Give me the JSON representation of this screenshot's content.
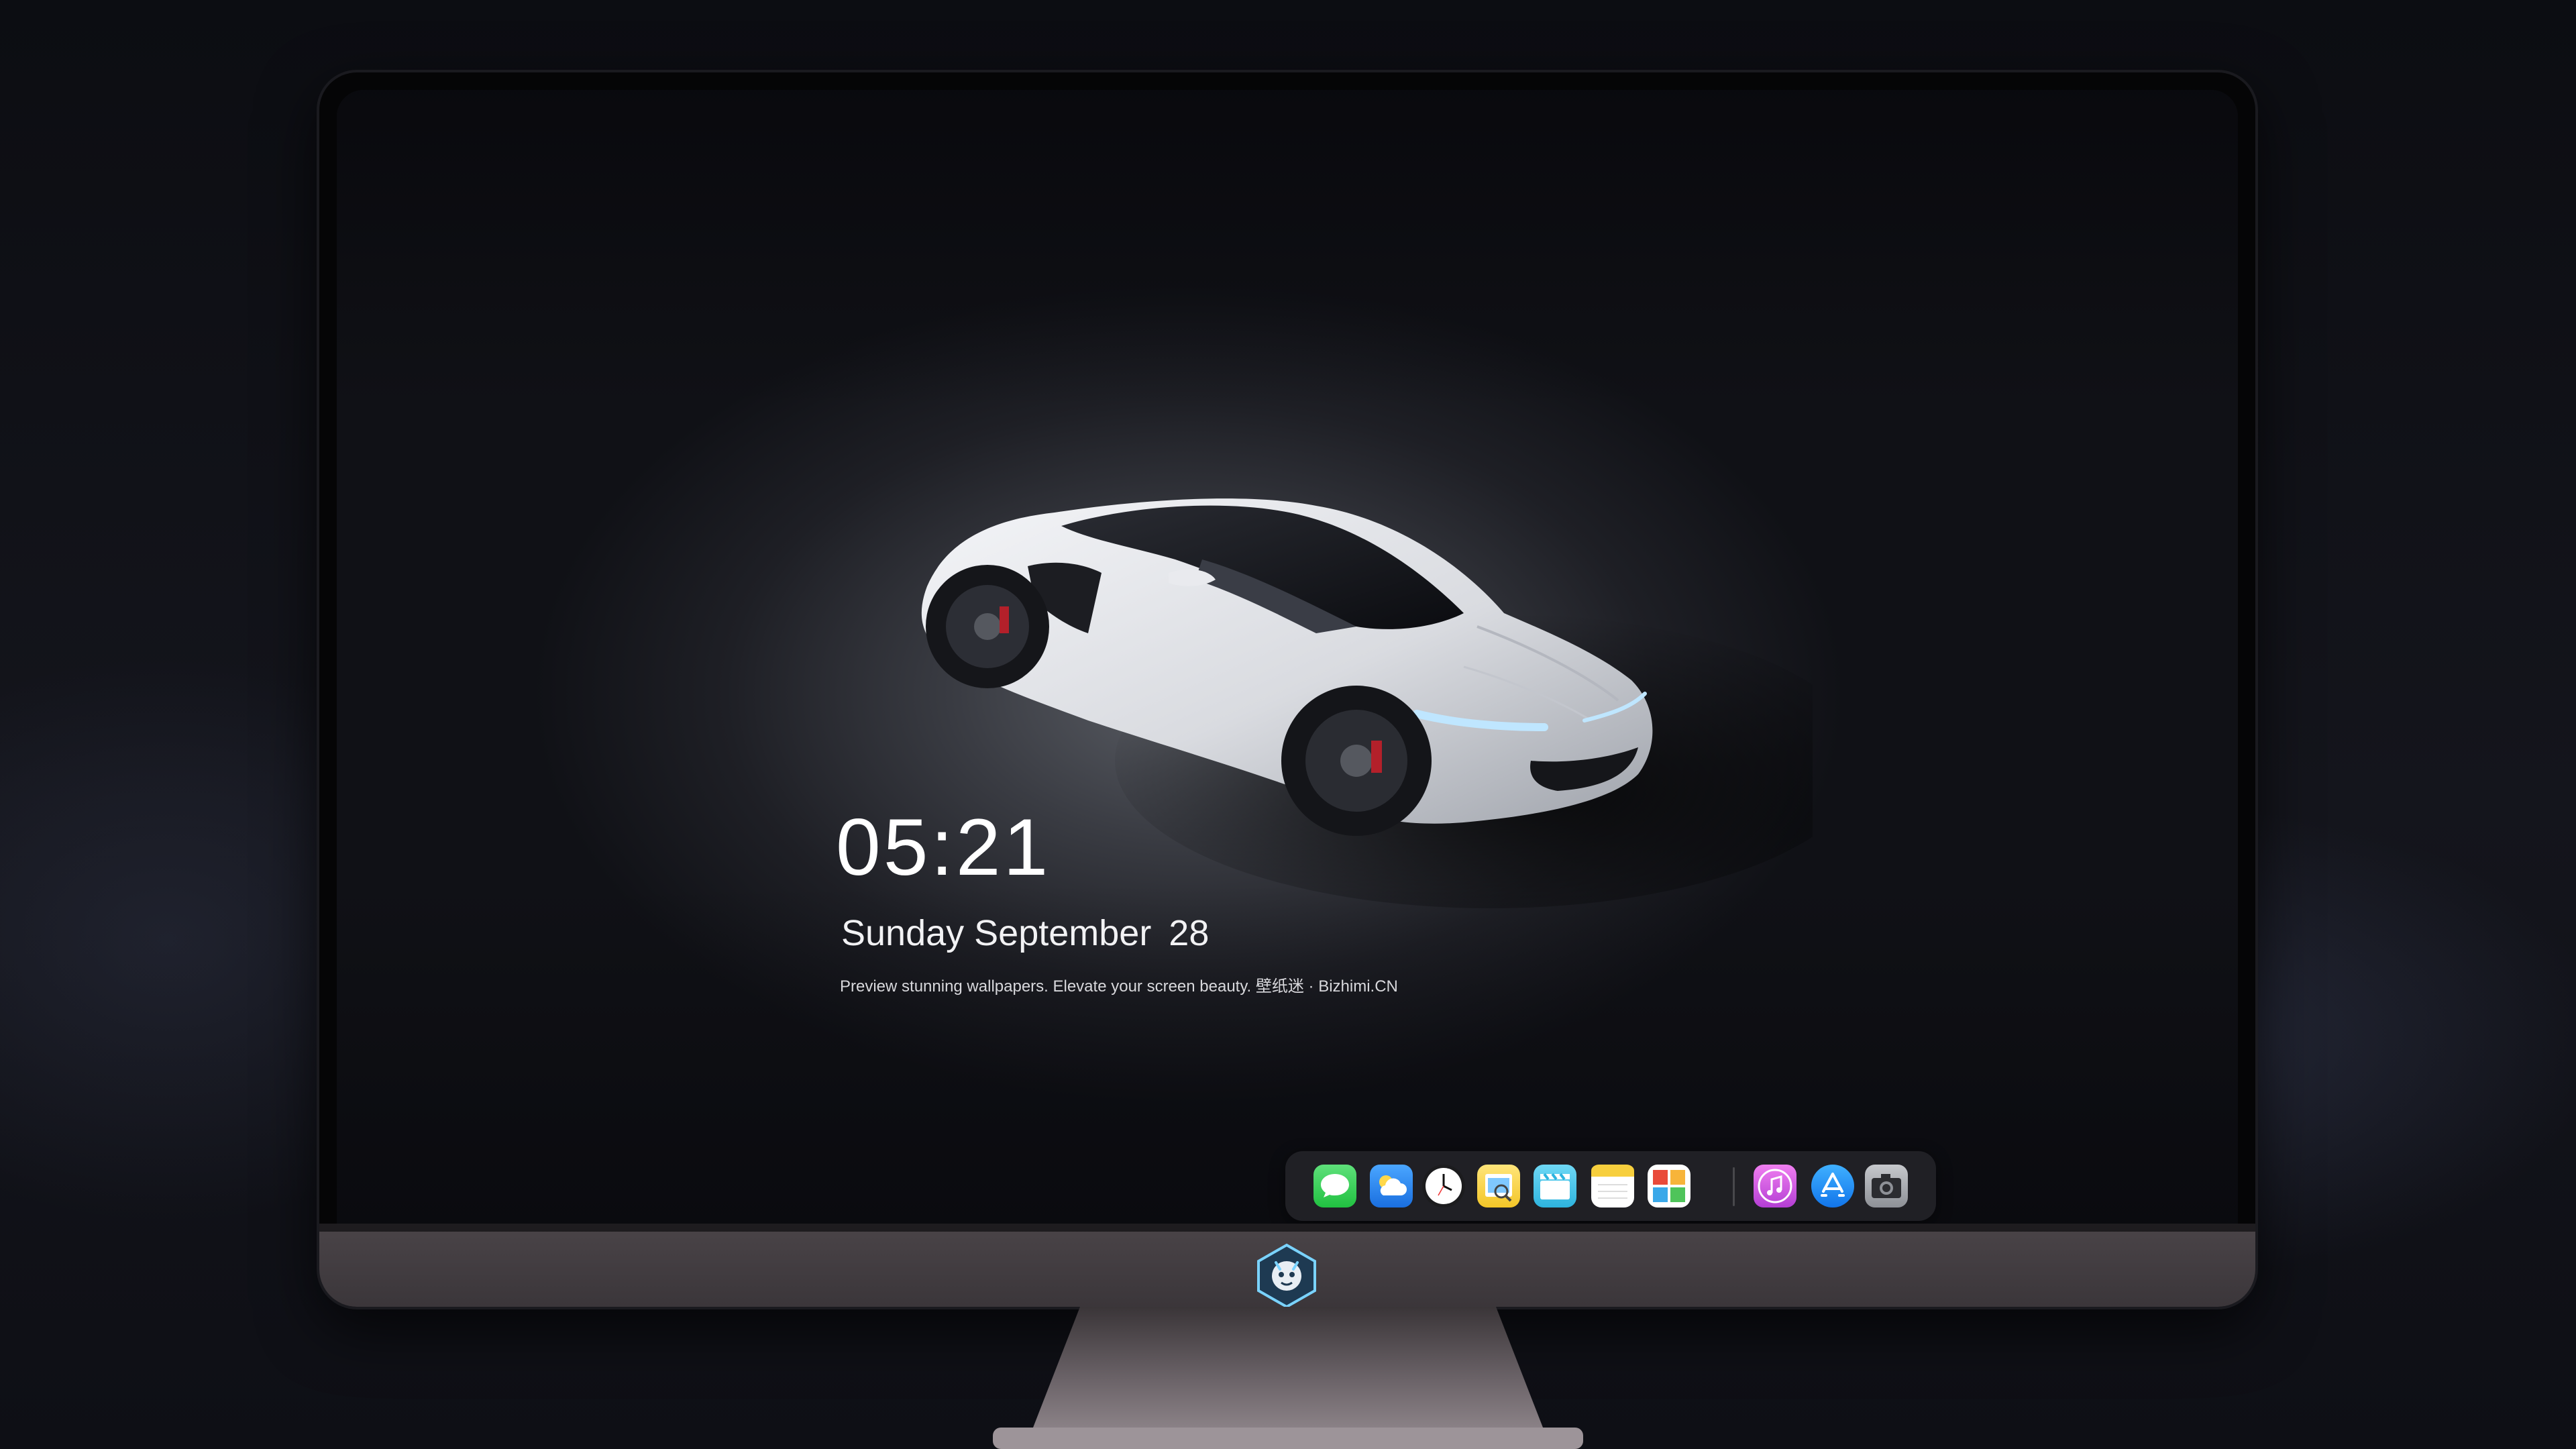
{
  "screen": {
    "clock": {
      "time": "05:21",
      "weekday_month": "Sunday September",
      "day": "28"
    },
    "tagline": "Preview stunning wallpapers. Elevate your screen beauty. 壁纸迷 · Bizhimi.CN"
  },
  "dock": {
    "apps": [
      {
        "name": "Messages",
        "icon": "messages-icon",
        "color": "#2fd158"
      },
      {
        "name": "Weather",
        "icon": "weather-icon",
        "color": "#2a86f0"
      },
      {
        "name": "Clock",
        "icon": "clock-icon",
        "color": "#ffffff"
      },
      {
        "name": "Preview",
        "icon": "preview-icon",
        "color": "#f6d23a"
      },
      {
        "name": "Clips",
        "icon": "clips-icon",
        "color": "#4bc6e8"
      },
      {
        "name": "Notes",
        "icon": "notes-icon",
        "color": "#f7cf3d"
      },
      {
        "name": "Photo Booth",
        "icon": "photo-booth-icon",
        "color": "#e94a3a"
      },
      {
        "name": "iTunes",
        "icon": "itunes-icon",
        "color": "#d24fd2"
      },
      {
        "name": "App Store",
        "icon": "app-store-icon",
        "color": "#1d8cf6"
      },
      {
        "name": "Camera",
        "icon": "camera-icon",
        "color": "#9ea2a8"
      }
    ]
  },
  "monitor": {
    "logo": "dragon-mascot-logo"
  },
  "colors": {
    "background": "#0d0e14",
    "chin": "#423d41",
    "dock": "#28282e"
  }
}
